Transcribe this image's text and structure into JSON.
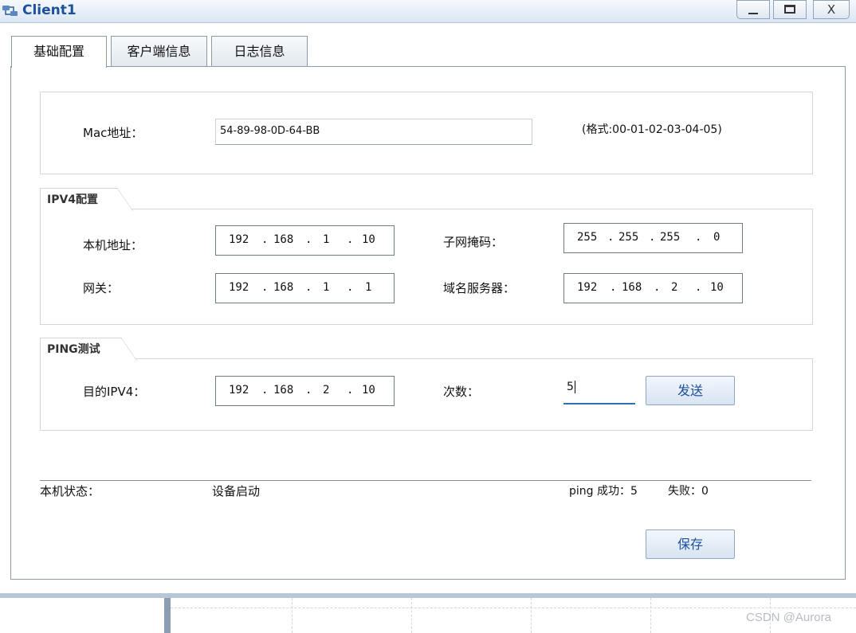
{
  "window": {
    "title": "Client1",
    "minimize_label": "_",
    "close_label": "X",
    "icon": "client-app-icon"
  },
  "tabs": [
    {
      "label": "基础配置",
      "active": true
    },
    {
      "label": "客户端信息",
      "active": false
    },
    {
      "label": "日志信息",
      "active": false
    }
  ],
  "mac": {
    "label": "Mac地址：",
    "value": "54-89-98-0D-64-BB",
    "hint": "(格式:00-01-02-03-04-05)"
  },
  "ipv4": {
    "section_title": "IPV4配置",
    "local_label": "本机地址：",
    "local_ip": [
      "192",
      "168",
      "1",
      "10"
    ],
    "mask_label": "子网掩码：",
    "mask": [
      "255",
      "255",
      "255",
      "0"
    ],
    "gateway_label": "网关：",
    "gateway": [
      "192",
      "168",
      "1",
      "1"
    ],
    "dns_label": "域名服务器：",
    "dns": [
      "192",
      "168",
      "2",
      "10"
    ]
  },
  "ping": {
    "section_title": "PING测试",
    "target_label": "目的IPV4：",
    "target": [
      "192",
      "168",
      "2",
      "10"
    ],
    "count_label": "次数：",
    "count_value": "5",
    "send_label": "发送"
  },
  "status": {
    "label": "本机状态：",
    "value": "设备启动",
    "ping_success": "ping 成功：5",
    "ping_fail": "失败：0"
  },
  "save_label": "保存",
  "watermark": "CSDN @Aurora",
  "colors": {
    "title_text": "#1c4f9c",
    "button_text": "#1c4f9c",
    "focus_underline": "#2f6fb5"
  }
}
